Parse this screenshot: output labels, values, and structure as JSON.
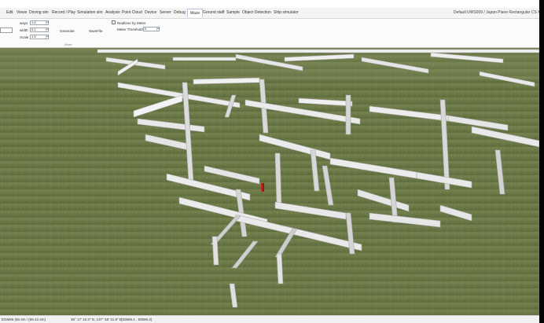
{
  "menubar": {
    "items": [
      {
        "label": "Edit"
      },
      {
        "label": "Views"
      },
      {
        "label": "Driving sim"
      },
      {
        "label": "Record / Play"
      },
      {
        "label": "Simulation sim"
      },
      {
        "label": "Analysis"
      },
      {
        "label": "Point Cloud"
      },
      {
        "label": "Device"
      },
      {
        "label": "Server"
      },
      {
        "label": "Debug"
      },
      {
        "label": "Maze"
      },
      {
        "label": "Ground staff"
      },
      {
        "label": "Sample"
      },
      {
        "label": "Object Detection"
      },
      {
        "label": "Ship simulator"
      }
    ],
    "active_index": 10,
    "right_profile": "Default",
    "right_version": "UWS009 / Japan Plane Rectangular CS X"
  },
  "ribbon": {
    "fields": [
      {
        "label": "ways",
        "value": "1.5"
      },
      {
        "label": "width",
        "value": "0.1"
      },
      {
        "label": "Scale",
        "value": "1.5"
      }
    ],
    "generate_label": "Generate",
    "save_label": "SaveFile",
    "realtime_label": "Realtime by Meter",
    "meter_threshold_label": "Meter Threshold",
    "meter_threshold_value": "0",
    "group_label": "Maze"
  },
  "status": {
    "left": "EGM96 (50.4m / (65.42.4m)",
    "coords": "36° 17' 10.3\" N, 137° 55' 41.8\" E",
    "extra": "(50596.4 , 50596.3)"
  },
  "colors": {
    "grass": "#6f7d4a",
    "wall_top": "#f2f2f2",
    "wall_side": "#cfcfcf",
    "marker": "#c0271e"
  }
}
